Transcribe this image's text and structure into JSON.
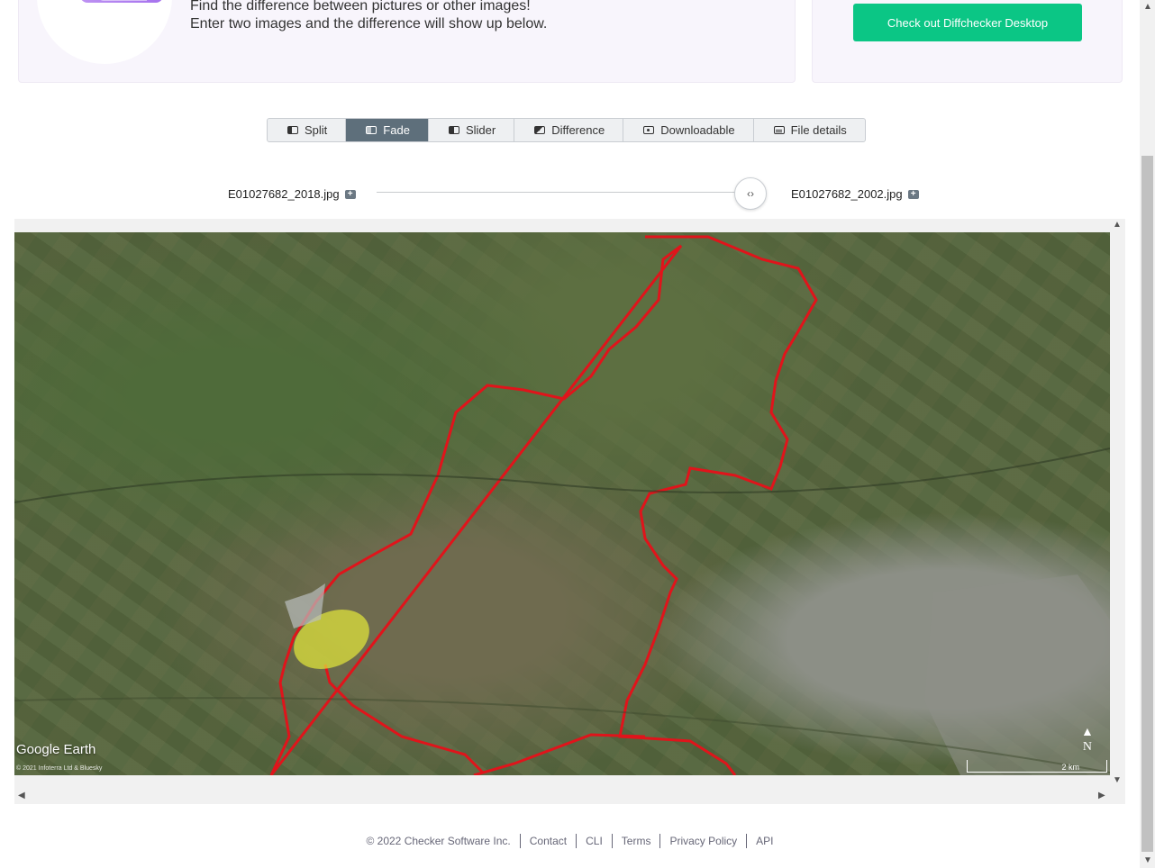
{
  "hero": {
    "line1": "Find the difference between pictures or other images!",
    "line2": "Enter two images and the difference will show up below."
  },
  "cta": {
    "label": "Check out Diffchecker Desktop"
  },
  "tabs": [
    {
      "label": "Split",
      "icon": "split-view-icon",
      "active": false
    },
    {
      "label": "Fade",
      "icon": "fade-icon",
      "active": true
    },
    {
      "label": "Slider",
      "icon": "slider-icon",
      "active": false
    },
    {
      "label": "Difference",
      "icon": "difference-icon",
      "active": false
    },
    {
      "label": "Downloadable",
      "icon": "camera-icon",
      "active": false
    },
    {
      "label": "File details",
      "icon": "table-icon",
      "active": false
    }
  ],
  "files": {
    "left": "E01027682_2018.jpg",
    "right": "E01027682_2002.jpg"
  },
  "fade_slider": {
    "value": 1.0
  },
  "map": {
    "logo": "Google Earth",
    "copyright": "© 2021 Infoterra Ltd & Bluesky",
    "north": "N",
    "scale": "2 km"
  },
  "footer": {
    "copyright": "© 2022 Checker Software Inc.",
    "links": [
      "Contact",
      "CLI",
      "Terms",
      "Privacy Policy",
      "API"
    ]
  },
  "colors": {
    "accent": "#0bc685",
    "active_tab": "#5e6f7b",
    "boundary": "#e0141b",
    "highlight": "#e4e83a"
  }
}
